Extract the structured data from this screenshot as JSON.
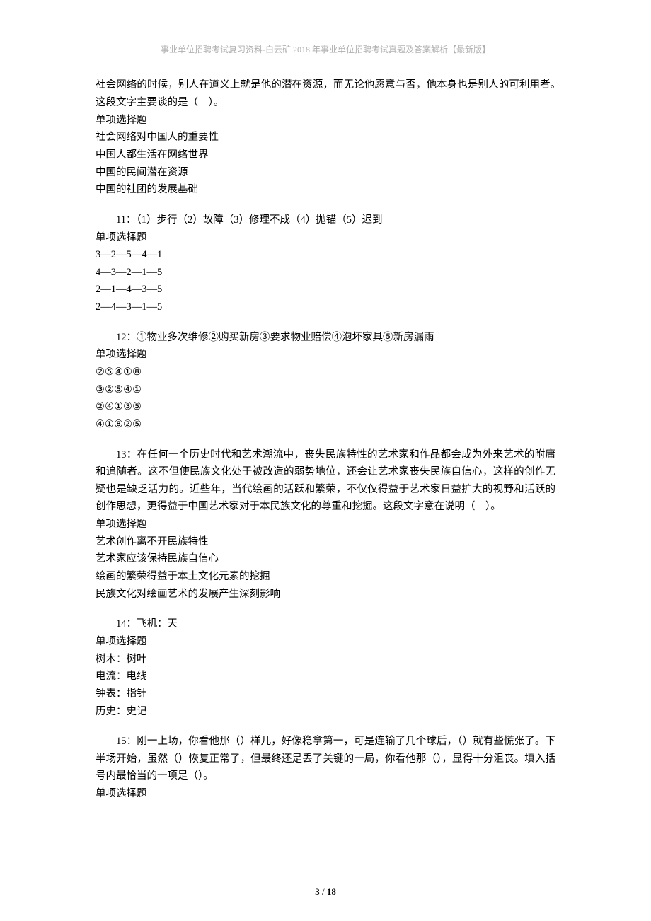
{
  "header": "事业单位招聘考试复习资料-白云矿 2018 年事业单位招聘考试真题及答案解析【最新版】",
  "q10_tail": {
    "l1": "社会网络的时候，别人在道义上就是他的潜在资源，而无论他愿意与否，他本身也是别人的可利用者。　　这段文字主要谈的是（　）。",
    "type": "单项选择题",
    "a": "社会网络对中国人的重要性",
    "b": "中国人都生活在网络世界",
    "c": "中国的民间潜在资源",
    "d": "中国的社团的发展基础"
  },
  "q11": {
    "stem": "11：（1）步行（2）故障（3）修理不成（4）抛锚（5）迟到",
    "type": "单项选择题",
    "a": "3—2—5—4—1",
    "b": "4—3—2—1—5",
    "c": "2—1—4—3—5",
    "d": "2—4—3—1—5"
  },
  "q12": {
    "stem": "12：①物业多次维修②购买新房③要求物业赔偿④泡坏家具⑤新房漏雨",
    "type": "单项选择题",
    "a": "②⑤④①⑧",
    "b": "③②⑤④①",
    "c": "②④①③⑤",
    "d": "④①⑧②⑤"
  },
  "q13": {
    "stem": "13：在任何一个历史时代和艺术潮流中，丧失民族特性的艺术家和作品都会成为外来艺术的附庸和追随者。这不但使民族文化处于被改造的弱势地位，还会让艺术家丧失民族自信心，这样的创作无疑也是缺乏活力的。近些年，当代绘画的活跃和繁荣，不仅仅得益于艺术家日益扩大的视野和活跃的创作思想，更得益于中国艺术家对于本民族文化的尊重和挖掘。这段文字意在说明（　）。",
    "type": "单项选择题",
    "a": "艺术创作离不开民族特性",
    "b": "艺术家应该保持民族自信心",
    "c": "绘画的繁荣得益于本土文化元素的挖掘",
    "d": "民族文化对绘画艺术的发展产生深刻影响"
  },
  "q14": {
    "stem": "14：飞机：天",
    "type": "单项选择题",
    "a": "树木：树叶",
    "b": "电流：电线",
    "c": "钟表：指针",
    "d": "历史：史记"
  },
  "q15": {
    "stem": "15：刚一上场，你看他那（）样儿，好像稳拿第一，可是连输了几个球后，（）就有些慌张了。下半场开始，虽然（）恢复正常了，但最终还是丢了关键的一局，你看他那（），显得十分沮丧。填入括号内最恰当的一项是（）。",
    "type": "单项选择题"
  },
  "footer": {
    "page": "3",
    "sep": " / ",
    "total": "18"
  }
}
